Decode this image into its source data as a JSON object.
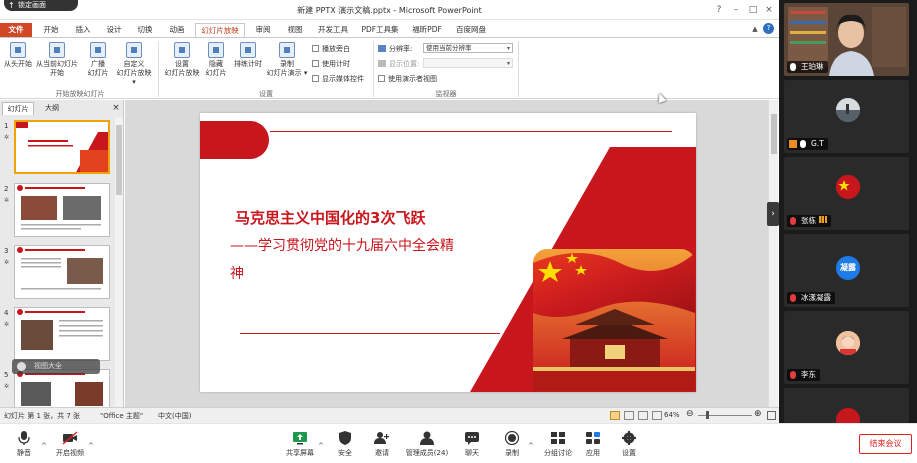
{
  "lock_badge": "锁定画面",
  "window": {
    "title": "新建 PPTX 演示文稿.pptx - Microsoft PowerPoint",
    "controls": [
      "?",
      "–",
      "□",
      "×"
    ]
  },
  "tabs": [
    "文件",
    "开始",
    "插入",
    "设计",
    "切换",
    "动画",
    "幻灯片放映",
    "审阅",
    "视图",
    "开发工具",
    "PDF工具集",
    "福昕PDF",
    "百度网盘"
  ],
  "active_tab": "幻灯片放映",
  "ribbon": {
    "start_group": {
      "label": "开始放映幻灯片",
      "buttons": [
        {
          "line1": "从头开始",
          "line2": ""
        },
        {
          "line1": "从当前幻灯片",
          "line2": "开始"
        },
        {
          "line1": "广播",
          "line2": "幻灯片"
        },
        {
          "line1": "自定义",
          "line2": "幻灯片放映 ▾"
        }
      ]
    },
    "setup_group": {
      "label": "设置",
      "buttons": [
        {
          "line1": "设置",
          "line2": "幻灯片放映"
        },
        {
          "line1": "隐藏",
          "line2": "幻灯片"
        },
        {
          "line1": "排练计时",
          "line2": ""
        },
        {
          "line1": "录制",
          "line2": "幻灯片演示 ▾"
        }
      ],
      "checks": [
        "播放旁白",
        "使用计时",
        "显示媒体控件"
      ]
    },
    "monitor_group": {
      "label": "监视器",
      "resolution_label": "分辨率:",
      "resolution_value": "使用当前分辨率",
      "display_label": "显示位置:",
      "presenter_check": "使用演示者视图"
    }
  },
  "thumb_pane": {
    "tabs": [
      "幻灯片",
      "大纲"
    ],
    "close": "×",
    "slide_numbers": [
      "1",
      "2",
      "3",
      "4",
      "5"
    ],
    "overlay_text": "视图大全"
  },
  "slide": {
    "title_line1": "马克思主义中国化的3次飞跃",
    "title_line2": "——学习贯彻党的十九届六中全会精",
    "title_line3": "神"
  },
  "status": {
    "slide_info": "幻灯片 第 1 张，共 7 张",
    "theme": "\"Office 主题\"",
    "language": "中文(中国)",
    "zoom": "64%"
  },
  "participants": [
    {
      "name": "王珀琳"
    },
    {
      "name": "G.T"
    },
    {
      "name": "张栋"
    },
    {
      "name": "冰漾凝露",
      "avatar_text": "凝露"
    },
    {
      "name": "李东"
    }
  ],
  "meeting_toolbar": {
    "buttons": [
      "静音",
      "开启视频",
      "共享屏幕",
      "安全",
      "邀请",
      "管理成员(24)",
      "聊天",
      "录制",
      "分组讨论",
      "应用",
      "设置"
    ],
    "end_label": "结束会议"
  },
  "colors": {
    "accent_red": "#c8161d",
    "ppt_orange": "#d24726",
    "end_red": "#e02020"
  }
}
